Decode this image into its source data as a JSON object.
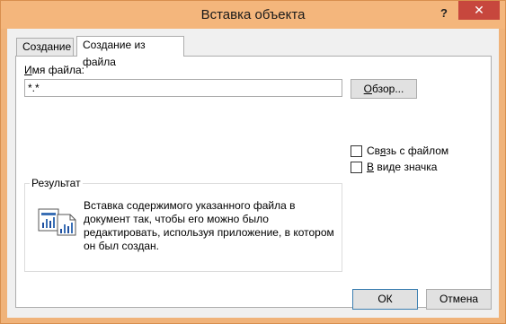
{
  "window": {
    "title": "Вставка объекта",
    "help_label": "?",
    "close_label": "✕"
  },
  "tabs": [
    {
      "label": "Создание"
    },
    {
      "label": "Создание из файла"
    }
  ],
  "form": {
    "filename_label_u": "И",
    "filename_label_rest": "мя файла:",
    "filename_value": "*.*",
    "browse_label_u": "О",
    "browse_label_rest": "бзор..."
  },
  "options": {
    "link_label_pre": "Св",
    "link_label_u": "я",
    "link_label_post": "зь с файлом",
    "link_checked": false,
    "icon_label_u": "В",
    "icon_label_post": " виде значка",
    "icon_checked": false
  },
  "result": {
    "legend": "Результат",
    "text": "Вставка содержимого указанного файла в документ так, чтобы его можно было редактировать, используя приложение, в котором он был создан.",
    "icon": "embedded-document-chart-icon"
  },
  "footer": {
    "ok_label": "ОК",
    "cancel_label": "Отмена"
  },
  "colors": {
    "titlebar": "#f4b67c",
    "close": "#c7473d",
    "accent_border": "#3c7fb1"
  }
}
